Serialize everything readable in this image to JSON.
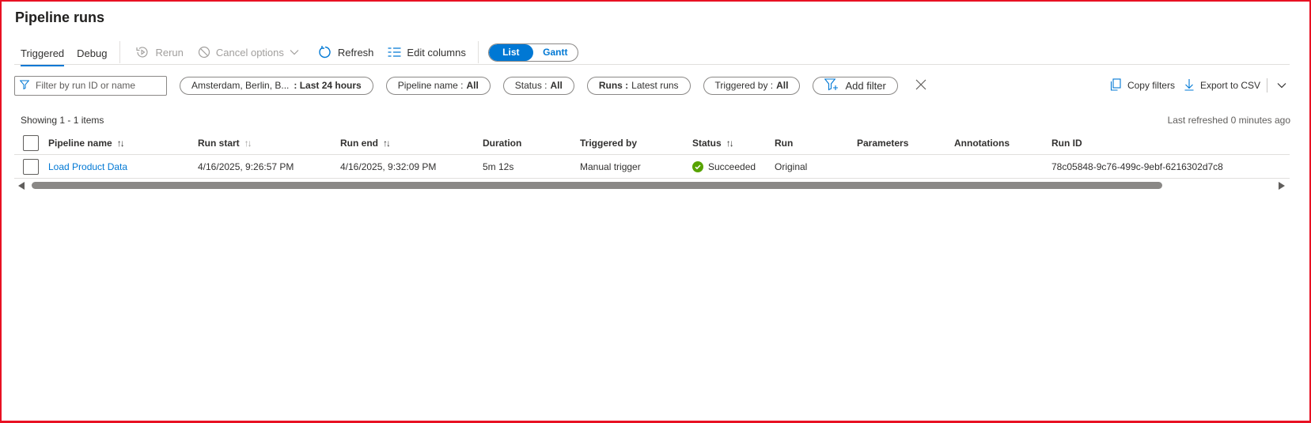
{
  "page": {
    "title": "Pipeline runs"
  },
  "toolbar": {
    "tabs": [
      {
        "label": "Triggered",
        "active": true
      },
      {
        "label": "Debug",
        "active": false
      }
    ],
    "rerun_label": "Rerun",
    "cancel_label": "Cancel options",
    "refresh_label": "Refresh",
    "edit_columns_label": "Edit columns",
    "view_toggle": {
      "list": "List",
      "gantt": "Gantt",
      "selected": "List"
    }
  },
  "filters": {
    "search_placeholder": "Filter by run ID or name",
    "timezone_text": "Amsterdam, Berlin, B...",
    "timerange_value": ": Last 24 hours",
    "pipeline_name_label": "Pipeline name :",
    "pipeline_name_value": "All",
    "status_label": "Status :",
    "status_value": "All",
    "runs_label": "Runs :",
    "runs_value": "Latest runs",
    "triggered_by_label": "Triggered by :",
    "triggered_by_value": "All",
    "add_filter_label": "Add filter",
    "copy_filters_label": "Copy filters",
    "export_label": "Export to CSV"
  },
  "summary": {
    "showing": "Showing 1 - 1 items",
    "last_refreshed": "Last refreshed 0 minutes ago"
  },
  "table": {
    "columns": [
      "Pipeline name",
      "Run start",
      "Run end",
      "Duration",
      "Triggered by",
      "Status",
      "Run",
      "Parameters",
      "Annotations",
      "Run ID"
    ],
    "rows": [
      {
        "pipeline_name": "Load Product Data",
        "run_start": "4/16/2025, 9:26:57 PM",
        "run_end": "4/16/2025, 9:32:09 PM",
        "duration": "5m 12s",
        "triggered_by": "Manual trigger",
        "status": "Succeeded",
        "run": "Original",
        "parameters": "",
        "annotations": "",
        "run_id": "78c05848-9c76-499c-9ebf-6216302d7c8"
      }
    ]
  },
  "colors": {
    "accent": "#0078d4",
    "success": "#57a300",
    "frame": "#e81123"
  },
  "icons": [
    "filter-icon",
    "rerun-icon",
    "cancel-icon",
    "chevron-down-icon",
    "refresh-icon",
    "edit-columns-icon",
    "add-filter-icon",
    "close-icon",
    "copy-icon",
    "download-icon",
    "sort-icon",
    "check-circle-icon"
  ]
}
